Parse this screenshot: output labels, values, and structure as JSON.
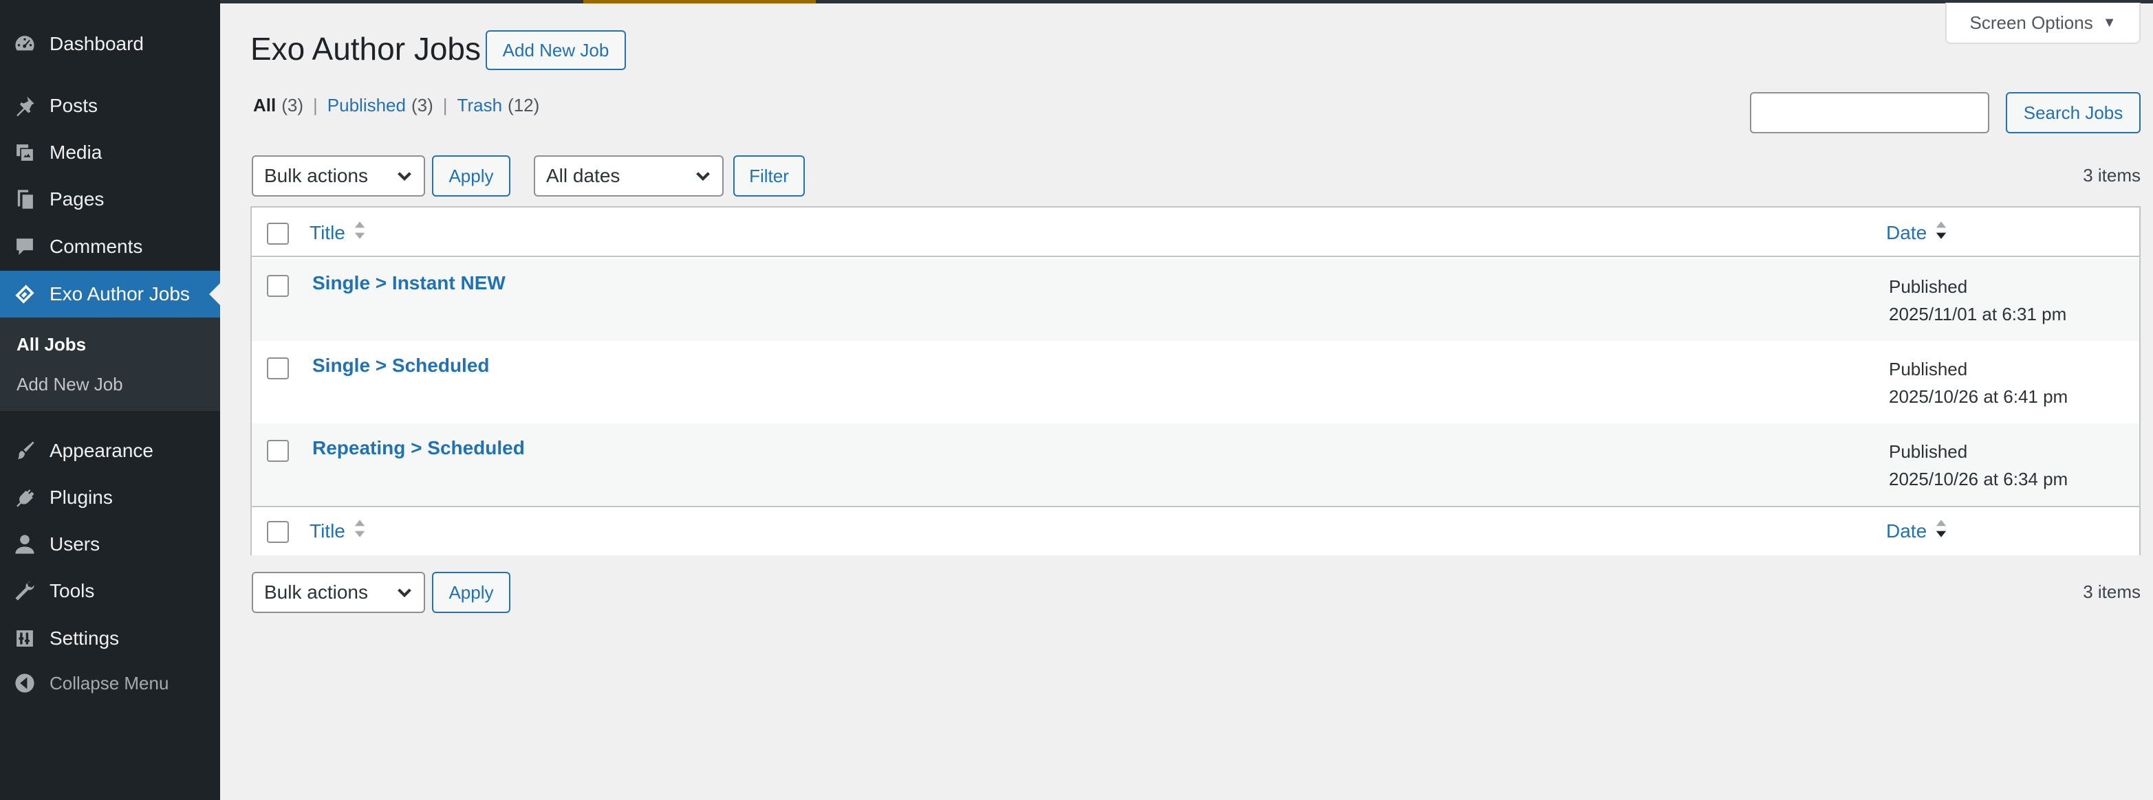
{
  "sidebar": {
    "items": [
      {
        "label": "Dashboard",
        "icon": "dashboard-icon"
      },
      {
        "label": "Posts",
        "icon": "pin-icon"
      },
      {
        "label": "Media",
        "icon": "media-icon"
      },
      {
        "label": "Pages",
        "icon": "pages-icon"
      },
      {
        "label": "Comments",
        "icon": "comment-icon"
      },
      {
        "label": "Exo Author Jobs",
        "icon": "jobs-icon",
        "current": true
      },
      {
        "label": "Appearance",
        "icon": "brush-icon"
      },
      {
        "label": "Plugins",
        "icon": "plug-icon"
      },
      {
        "label": "Users",
        "icon": "user-icon"
      },
      {
        "label": "Tools",
        "icon": "wrench-icon"
      },
      {
        "label": "Settings",
        "icon": "settings-icon"
      }
    ],
    "submenu": [
      {
        "label": "All Jobs",
        "current": true
      },
      {
        "label": "Add New Job"
      }
    ],
    "collapse_label": "Collapse Menu"
  },
  "header": {
    "screen_options": "Screen Options",
    "title": "Exo Author Jobs",
    "add_new": "Add New Job"
  },
  "views": [
    {
      "label": "All",
      "count": "(3)",
      "current": true
    },
    {
      "label": "Published",
      "count": "(3)"
    },
    {
      "label": "Trash",
      "count": "(12)"
    }
  ],
  "search": {
    "value": "",
    "button": "Search Jobs"
  },
  "top_nav": {
    "bulk_actions": "Bulk actions",
    "apply": "Apply",
    "dates": "All dates",
    "filter": "Filter",
    "items": "3 items"
  },
  "bottom_nav": {
    "bulk_actions": "Bulk actions",
    "apply": "Apply",
    "items": "3 items"
  },
  "table": {
    "columns": {
      "title": "Title",
      "date": "Date"
    },
    "rows": [
      {
        "title": "Single > Instant NEW",
        "status": "Published",
        "date": "2025/11/01 at 6:31 pm"
      },
      {
        "title": "Single > Scheduled",
        "status": "Published",
        "date": "2025/10/26 at 6:41 pm"
      },
      {
        "title": "Repeating > Scheduled",
        "status": "Published",
        "date": "2025/10/26 at 6:34 pm"
      }
    ]
  },
  "colors": {
    "sidebar_bg": "#1d2327",
    "accent": "#2271b1",
    "page_bg": "#f0f0f1"
  }
}
